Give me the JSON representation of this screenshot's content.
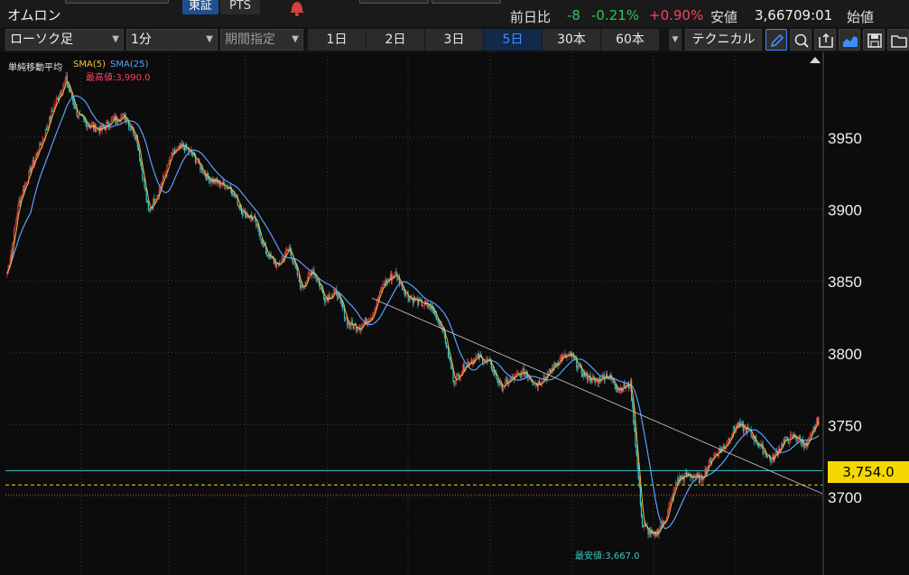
{
  "header": {
    "stock_name": "オムロン",
    "markets": [
      "東証",
      "PTS"
    ],
    "quote_labels": {
      "prev_diff": "前日比",
      "low": "安値",
      "open": "始値"
    },
    "prev_diff": "-8",
    "prev_diff_pct": "-0.21%",
    "other_pct": "+0.90%",
    "low_value": "3,667",
    "low_time": "09:01"
  },
  "toolbar": {
    "chart_type": "ローソク足",
    "interval": "1分",
    "period_placeholder": "期間指定",
    "ranges": [
      "1日",
      "2日",
      "3日",
      "5日",
      "30本",
      "60本"
    ],
    "active_range": "5日",
    "technical_label": "テクニカル",
    "tools": [
      "pen-icon",
      "zoom-icon",
      "export-icon",
      "area-chart-icon",
      "save-icon",
      "folder-icon"
    ]
  },
  "indicator": {
    "name": "単純移動平均",
    "series": [
      {
        "name": "SMA(5)",
        "color": "#f0c040"
      },
      {
        "name": "SMA(25)",
        "color": "#5aa0ff"
      }
    ]
  },
  "annotations": {
    "high_label": "最高値:3,990.0",
    "low_label": "最安値:3,667.0"
  },
  "current_price": "3,754.0",
  "y_axis_ticks": [
    "3950",
    "3900",
    "3850",
    "3800",
    "3750",
    "3700"
  ],
  "colors": {
    "up": "#e04040",
    "down": "#3cc8c8",
    "sma5": "#f0c040",
    "sma25": "#5aa0ff",
    "price_tag": "#f5d800",
    "active_tab": "#3f8cff",
    "negative": "#2ec45a",
    "positive": "#ff4060"
  },
  "chart_data": {
    "type": "candlestick",
    "interval": "1分",
    "range": "5日",
    "ylim": [
      3660,
      4000
    ],
    "y_ticks": [
      3700,
      3750,
      3800,
      3850,
      3900,
      3950
    ],
    "high": 3990.0,
    "low": 3667.0,
    "last": 3754.0,
    "close_path": [
      3855,
      3905,
      3928,
      3948,
      3972,
      3990,
      3965,
      3958,
      3955,
      3962,
      3965,
      3950,
      3898,
      3915,
      3938,
      3944,
      3935,
      3922,
      3918,
      3915,
      3898,
      3893,
      3870,
      3860,
      3873,
      3845,
      3858,
      3838,
      3842,
      3820,
      3818,
      3826,
      3848,
      3855,
      3840,
      3835,
      3832,
      3818,
      3780,
      3792,
      3797,
      3793,
      3776,
      3782,
      3787,
      3778,
      3785,
      3796,
      3798,
      3785,
      3780,
      3785,
      3775,
      3778,
      3680,
      3672,
      3685,
      3712,
      3715,
      3712,
      3728,
      3735,
      3750,
      3746,
      3735,
      3725,
      3738,
      3742,
      3735,
      3755
    ],
    "horizontal_lines": [
      {
        "value": 3718,
        "style": "solid",
        "color": "#3cc8c8"
      },
      {
        "value": 3708,
        "style": "dashed",
        "color": "#f5d800"
      },
      {
        "value": 3701,
        "style": "dotted",
        "color": "#e04040"
      }
    ],
    "trend_line": {
      "from": [
        31,
        3838
      ],
      "to": [
        69,
        3702
      ]
    }
  }
}
